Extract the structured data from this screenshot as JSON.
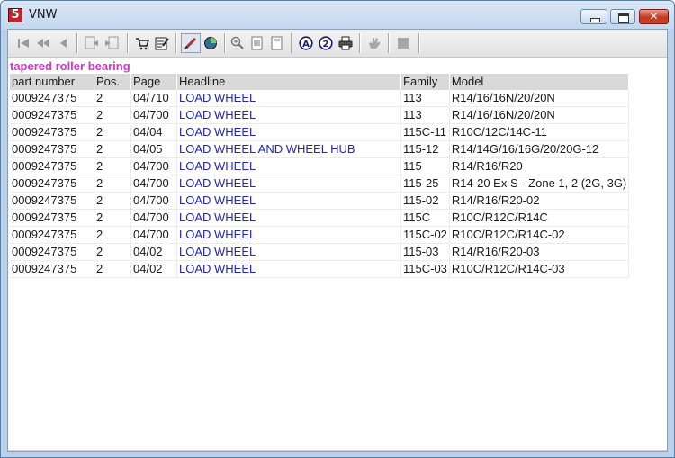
{
  "window": {
    "title": "VNW",
    "app_icon_glyph": "5",
    "close_glyph": "✕"
  },
  "toolbar": {
    "icons": [
      "first-record-icon",
      "previous-page-icon",
      "previous-record-icon",
      "export-left-icon",
      "export-right-icon",
      "cart-icon",
      "edit-checklist-icon",
      "pencil-marker-icon",
      "pie-chart-icon",
      "zoom-in-icon",
      "page-icon",
      "page-alt-icon",
      "circle-a-icon",
      "circle-2-icon",
      "print-icon",
      "hand-grey-icon",
      "stop-grey-icon"
    ]
  },
  "caption": "tapered roller bearing",
  "table": {
    "columns": [
      "part number",
      "Pos.",
      "Page",
      "Headline",
      "Family",
      "Model"
    ],
    "rows": [
      [
        "0009247375",
        "2",
        "04/710",
        "LOAD WHEEL",
        "113",
        "R14/16/16N/20/20N"
      ],
      [
        "0009247375",
        "2",
        "04/700",
        "LOAD WHEEL",
        "113",
        "R14/16/16N/20/20N"
      ],
      [
        "0009247375",
        "2",
        "04/04",
        "LOAD WHEEL",
        "115C-11",
        "R10C/12C/14C-11"
      ],
      [
        "0009247375",
        "2",
        "04/05",
        "LOAD WHEEL AND WHEEL HUB",
        "115-12",
        "R14/14G/16/16G/20/20G-12"
      ],
      [
        "0009247375",
        "2",
        "04/700",
        "LOAD WHEEL",
        "115",
        "R14/R16/R20"
      ],
      [
        "0009247375",
        "2",
        "04/700",
        "LOAD WHEEL",
        "115-25",
        "R14-20 Ex S - Zone 1, 2 (2G, 3G)"
      ],
      [
        "0009247375",
        "2",
        "04/700",
        "LOAD WHEEL",
        "115-02",
        "R14/R16/R20-02"
      ],
      [
        "0009247375",
        "2",
        "04/700",
        "LOAD WHEEL",
        "115C",
        "R10C/R12C/R14C"
      ],
      [
        "0009247375",
        "2",
        "04/700",
        "LOAD WHEEL",
        "115C-02",
        "R10C/R12C/R14C-02"
      ],
      [
        "0009247375",
        "2",
        "04/02",
        "LOAD WHEEL",
        "115-03",
        "R14/R16/R20-03"
      ],
      [
        "0009247375",
        "2",
        "04/02",
        "LOAD WHEEL",
        "115C-03",
        "R10C/R12C/R14C-03"
      ]
    ]
  },
  "colors": {
    "caption": "#d633c8",
    "headline_link": "#2326b6",
    "header_bg": "#d9d9d9"
  }
}
